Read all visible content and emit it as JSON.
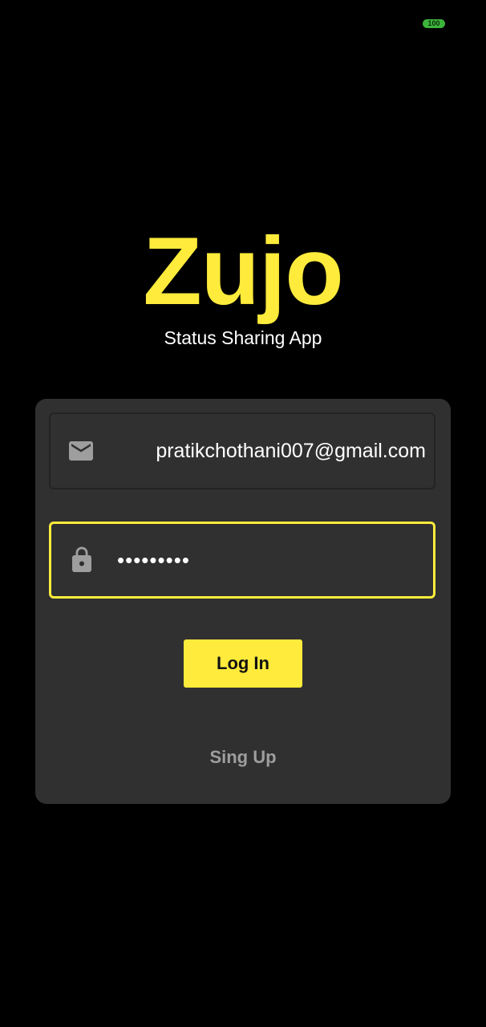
{
  "status_bar": {
    "battery_level": "100",
    "battery_color": "#3cb43c"
  },
  "brand": {
    "logo": "Zujo",
    "tagline": "Status Sharing App",
    "accent_color": "#ffeb3b"
  },
  "login_form": {
    "email": {
      "icon": "mail-icon",
      "value": "pratikchothani007@gmail.com"
    },
    "password": {
      "icon": "lock-icon",
      "value": "•••••••••",
      "focused": true
    },
    "login_label": "Log In",
    "signup_label": "Sing Up"
  },
  "colors": {
    "background": "#000000",
    "card": "#303030",
    "muted_text": "#9e9e9e"
  }
}
